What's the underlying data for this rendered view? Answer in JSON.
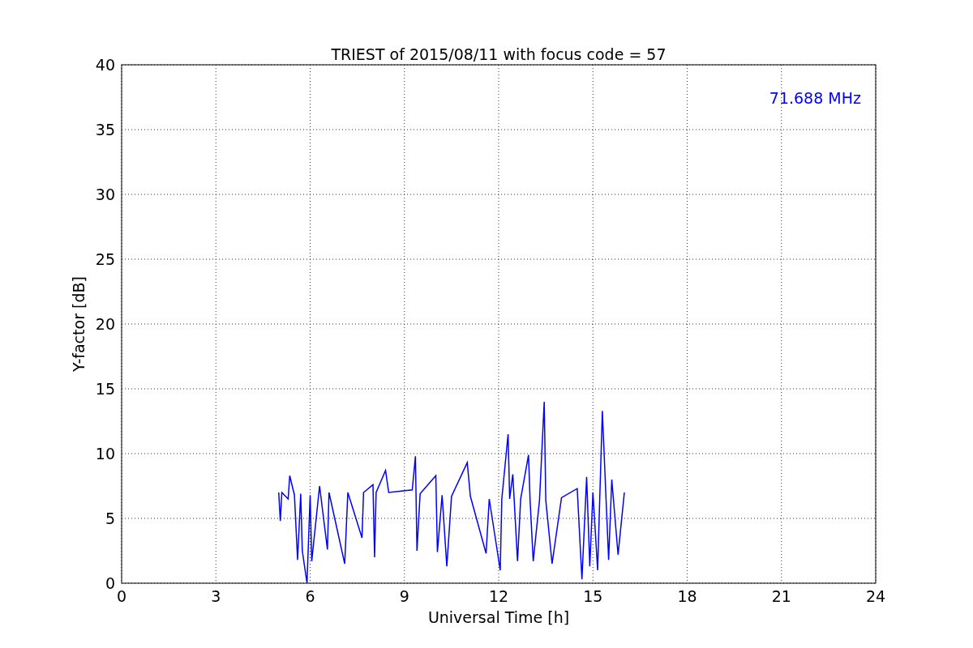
{
  "figure": {
    "chart_data": {
      "type": "line",
      "title": "TRIEST of 2015/08/11 with focus code = 57",
      "xlabel": "Universal Time [h]",
      "ylabel": "Y-factor [dB]",
      "xlim": [
        0,
        24
      ],
      "ylim": [
        0,
        40
      ],
      "xticks": [
        0,
        3,
        6,
        9,
        12,
        15,
        18,
        21,
        24
      ],
      "yticks": [
        0,
        5,
        10,
        15,
        20,
        25,
        30,
        35,
        40
      ],
      "x": [
        5.0,
        5.05,
        5.1,
        5.3,
        5.35,
        5.5,
        5.6,
        5.7,
        5.75,
        5.9,
        6.0,
        6.05,
        6.3,
        6.55,
        6.6,
        7.1,
        7.2,
        7.65,
        7.7,
        8.0,
        8.05,
        8.1,
        8.4,
        8.5,
        9.25,
        9.35,
        9.4,
        9.5,
        10.0,
        10.05,
        10.2,
        10.35,
        10.5,
        11.0,
        11.1,
        11.6,
        11.7,
        12.05,
        12.1,
        12.3,
        12.35,
        12.45,
        12.6,
        12.7,
        12.95,
        13.0,
        13.1,
        13.3,
        13.45,
        13.5,
        13.7,
        14.0,
        14.5,
        14.65,
        14.8,
        14.9,
        15.0,
        15.15,
        15.3,
        15.4,
        15.5,
        15.6,
        15.8,
        16.0
      ],
      "series": [
        {
          "name": "71.688 MHz",
          "color": "#0000ff",
          "values": [
            7,
            4.8,
            7,
            6.5,
            8.3,
            6.8,
            1.8,
            6.9,
            2.5,
            0,
            6.8,
            1.7,
            7.5,
            2.6,
            7,
            1.5,
            7,
            3.5,
            7,
            7.6,
            2,
            7,
            8.7,
            7,
            7.2,
            9.8,
            2.5,
            6.9,
            8.3,
            2.4,
            6.8,
            1.3,
            6.7,
            9.3,
            6.7,
            2.3,
            6.5,
            1,
            6.5,
            11.5,
            6.5,
            8.4,
            1.7,
            6.5,
            9.9,
            6.4,
            1.7,
            6.4,
            14,
            6.4,
            1.5,
            6.6,
            7.3,
            0.3,
            8.2,
            1.3,
            7,
            1,
            13.3,
            7.5,
            1.8,
            8,
            2.2,
            7
          ]
        }
      ],
      "grid": true
    }
  }
}
